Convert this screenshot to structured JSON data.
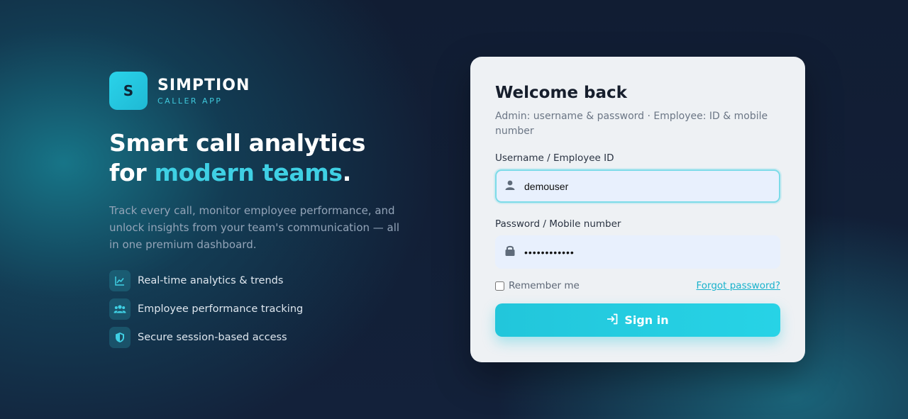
{
  "brand": {
    "logo_letter": "S",
    "name": "SIMPTION",
    "subtitle": "CALLER APP",
    "accent_color": "#2ad3ea"
  },
  "hero": {
    "headline_line1": "Smart call analytics",
    "headline_prefix": "for ",
    "headline_accent": "modern teams",
    "headline_suffix": ".",
    "description": "Track every call, monitor employee performance, and unlock insights from your team's communication — all in one premium dashboard."
  },
  "features": [
    {
      "icon": "chart-line-icon",
      "text": "Real-time analytics & trends"
    },
    {
      "icon": "users-icon",
      "text": "Employee performance tracking"
    },
    {
      "icon": "shield-icon",
      "text": "Secure session-based access"
    }
  ],
  "login": {
    "title": "Welcome back",
    "subtitle": "Admin: username & password  ·  Employee: ID & mobile number",
    "username_label": "Username / Employee ID",
    "username_value": "demouser",
    "password_label": "Password / Mobile number",
    "password_value": "••••••••••••",
    "remember_label": "Remember me",
    "forgot_label": "Forgot password?",
    "signin_label": "Sign in"
  }
}
